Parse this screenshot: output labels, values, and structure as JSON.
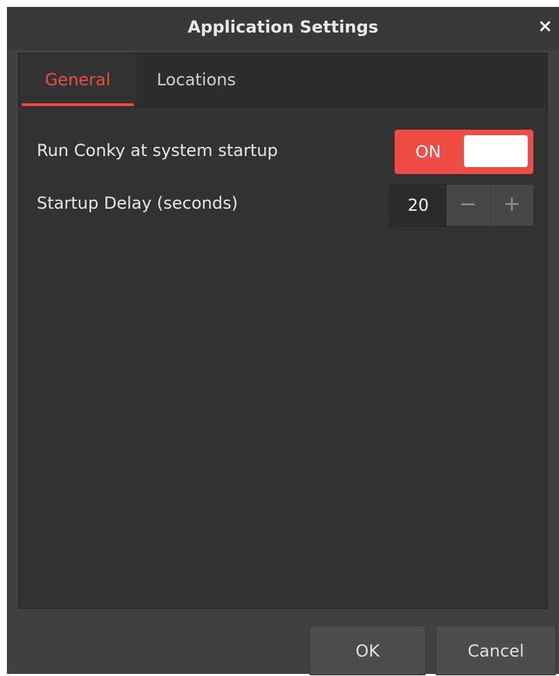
{
  "window": {
    "title": "Application Settings",
    "close_glyph": "×"
  },
  "tabs": [
    {
      "label": "General",
      "active": true
    },
    {
      "label": "Locations",
      "active": false
    }
  ],
  "general": {
    "startup_label": "Run Conky at system startup",
    "startup_switch": {
      "state": "ON",
      "on": true
    },
    "delay_label": "Startup Delay (seconds)",
    "delay_value": "20",
    "minus_glyph": "−",
    "plus_glyph": "+"
  },
  "buttons": {
    "ok": "OK",
    "cancel": "Cancel"
  },
  "colors": {
    "accent": "#ee4c45",
    "background": "#323232",
    "titlebar": "#393939"
  },
  "icons": {
    "close": "close-icon",
    "minus": "minus-icon",
    "plus": "plus-icon"
  }
}
